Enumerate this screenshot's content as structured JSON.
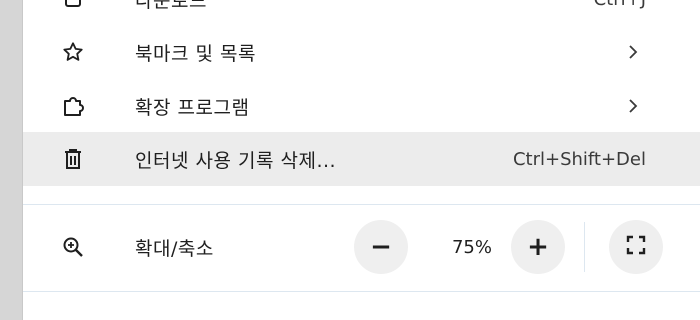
{
  "menu": {
    "partial_item": {
      "label": "다운로드",
      "shortcut": "Ctrl+J"
    },
    "bookmarks": {
      "label": "북마크 및 목록",
      "icon": "star-icon"
    },
    "extensions": {
      "label": "확장 프로그램",
      "icon": "puzzle-icon"
    },
    "clear_history": {
      "label": "인터넷 사용 기록 삭제...",
      "shortcut": "Ctrl+Shift+Del",
      "icon": "trash-icon"
    },
    "zoom": {
      "label": "확대/축소",
      "value": "75%",
      "minus_label": "−",
      "plus_label": "+",
      "icon": "zoom-in-icon",
      "fullscreen_icon": "fullscreen-icon"
    }
  },
  "colors": {
    "hover_bg": "#ececec",
    "button_bg": "#efefef",
    "divider": "#dde7f0"
  }
}
